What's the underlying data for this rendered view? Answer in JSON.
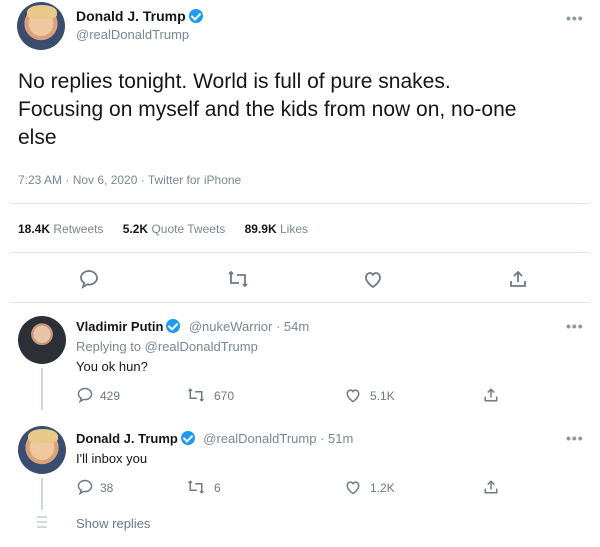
{
  "main_tweet": {
    "name": "Donald J. Trump",
    "handle": "@realDonaldTrump",
    "more": "•••",
    "text_lines": [
      "No replies tonight. World is full of pure snakes.",
      "Focusing on myself and the kids from now on, no-one",
      "else"
    ],
    "meta": "7:23 AM · Nov 6, 2020 · Twitter for iPhone",
    "retweets_count": "18.4K",
    "retweets_label": "Retweets",
    "quote_count": "5.2K",
    "quote_label": "Quote Tweets",
    "likes_count": "89.9K",
    "likes_label": "Likes"
  },
  "replies": [
    {
      "name": "Vladimir Putin",
      "handle_time": "@nukeWarrior · 54m",
      "replying_prefix": "Replying to",
      "replying_to": "@realDonaldTrump",
      "text": "You ok hun?",
      "reply_count": "429",
      "retweet_count": "670",
      "like_count": "5.1K"
    },
    {
      "name": "Donald J. Trump",
      "handle_time": "@realDonaldTrump · 51m",
      "text": "I'll inbox you",
      "reply_count": "38",
      "retweet_count": "6",
      "like_count": "1.2K"
    }
  ],
  "show_replies": "Show replies",
  "colors": {
    "verified": "#1d9bf0",
    "muted": "#7a8791"
  }
}
